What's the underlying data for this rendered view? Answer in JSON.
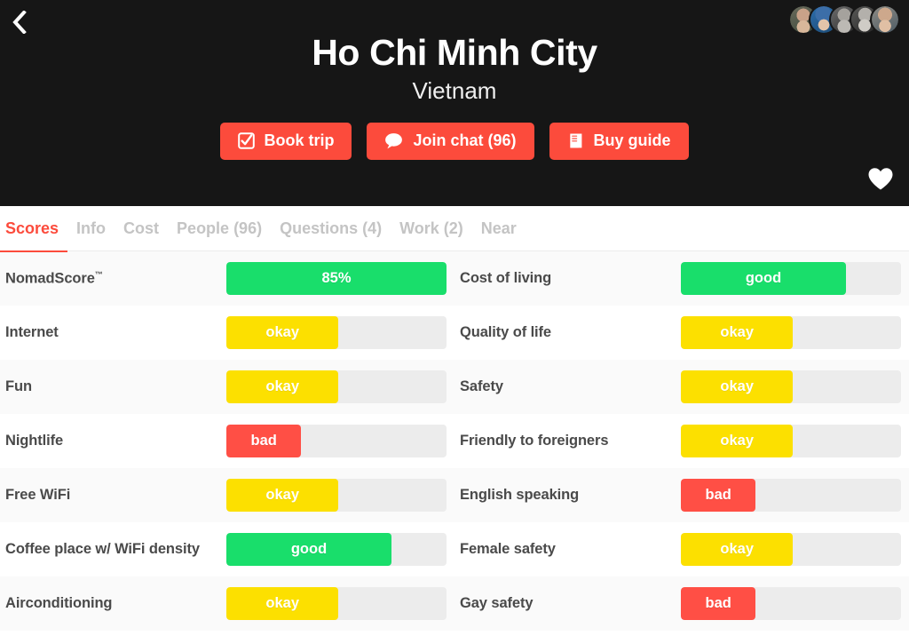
{
  "header": {
    "title": "Ho Chi Minh City",
    "subtitle": "Vietnam",
    "back_label": "Back",
    "favorite_label": "Favorite",
    "avatar_count": 5,
    "buttons": [
      {
        "label": "Book trip",
        "icon": "checkbox-icon"
      },
      {
        "label": "Join chat (96)",
        "icon": "chat-bubble-icon"
      },
      {
        "label": "Buy guide",
        "icon": "book-icon"
      }
    ],
    "colors": {
      "background": "#161616",
      "button": "#fc4b3c",
      "title_text": "#ffffff"
    }
  },
  "tabs": {
    "active": "Scores",
    "items": [
      {
        "label": "Scores",
        "active": true
      },
      {
        "label": "Info",
        "active": false
      },
      {
        "label": "Cost",
        "active": false
      },
      {
        "label": "People (96)",
        "active": false
      },
      {
        "label": "Questions (4)",
        "active": false
      },
      {
        "label": "Work (2)",
        "active": false
      },
      {
        "label": "Near",
        "active": false
      }
    ],
    "colors": {
      "active": "#fc4b3c",
      "inactive": "#c4c4c4"
    }
  },
  "scores": {
    "colors": {
      "good": "#19de6b",
      "okay": "#fce000",
      "bad": "#ff4f45",
      "track": "#ececec"
    },
    "left_column": [
      {
        "label": "NomadScore",
        "trademark": "™",
        "value": "85%",
        "rating": "good",
        "percent": 100
      },
      {
        "label": "Internet",
        "trademark": "",
        "value": "okay",
        "rating": "okay",
        "percent": 51
      },
      {
        "label": "Fun",
        "trademark": "",
        "value": "okay",
        "rating": "okay",
        "percent": 51
      },
      {
        "label": "Nightlife",
        "trademark": "",
        "value": "bad",
        "rating": "bad",
        "percent": 34
      },
      {
        "label": "Free WiFi",
        "trademark": "",
        "value": "okay",
        "rating": "okay",
        "percent": 51
      },
      {
        "label": "Coffee place w/ WiFi density",
        "trademark": "",
        "value": "good",
        "rating": "good",
        "percent": 75
      },
      {
        "label": "Airconditioning",
        "trademark": "",
        "value": "okay",
        "rating": "okay",
        "percent": 51
      }
    ],
    "right_column": [
      {
        "label": "Cost of living",
        "trademark": "",
        "value": "good",
        "rating": "good",
        "percent": 75
      },
      {
        "label": "Quality of life",
        "trademark": "",
        "value": "okay",
        "rating": "okay",
        "percent": 51
      },
      {
        "label": "Safety",
        "trademark": "",
        "value": "okay",
        "rating": "okay",
        "percent": 51
      },
      {
        "label": "Friendly to foreigners",
        "trademark": "",
        "value": "okay",
        "rating": "okay",
        "percent": 51
      },
      {
        "label": "English speaking",
        "trademark": "",
        "value": "bad",
        "rating": "bad",
        "percent": 34
      },
      {
        "label": "Female safety",
        "trademark": "",
        "value": "okay",
        "rating": "okay",
        "percent": 51
      },
      {
        "label": "Gay safety",
        "trademark": "",
        "value": "bad",
        "rating": "bad",
        "percent": 34
      }
    ]
  }
}
